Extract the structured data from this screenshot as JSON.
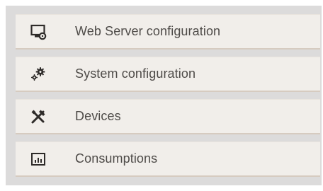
{
  "menu": {
    "items": [
      {
        "icon": "web-server-icon",
        "label": "Web Server configuration"
      },
      {
        "icon": "gears-icon",
        "label": "System configuration"
      },
      {
        "icon": "tools-icon",
        "label": "Devices"
      },
      {
        "icon": "chart-icon",
        "label": "Consumptions"
      }
    ]
  },
  "colors": {
    "panel_background": "#dcdbdb",
    "item_background": "#f1eeea",
    "item_border": "#d6cbc0",
    "text": "#4e4b48",
    "icon": "#2e2b29"
  }
}
